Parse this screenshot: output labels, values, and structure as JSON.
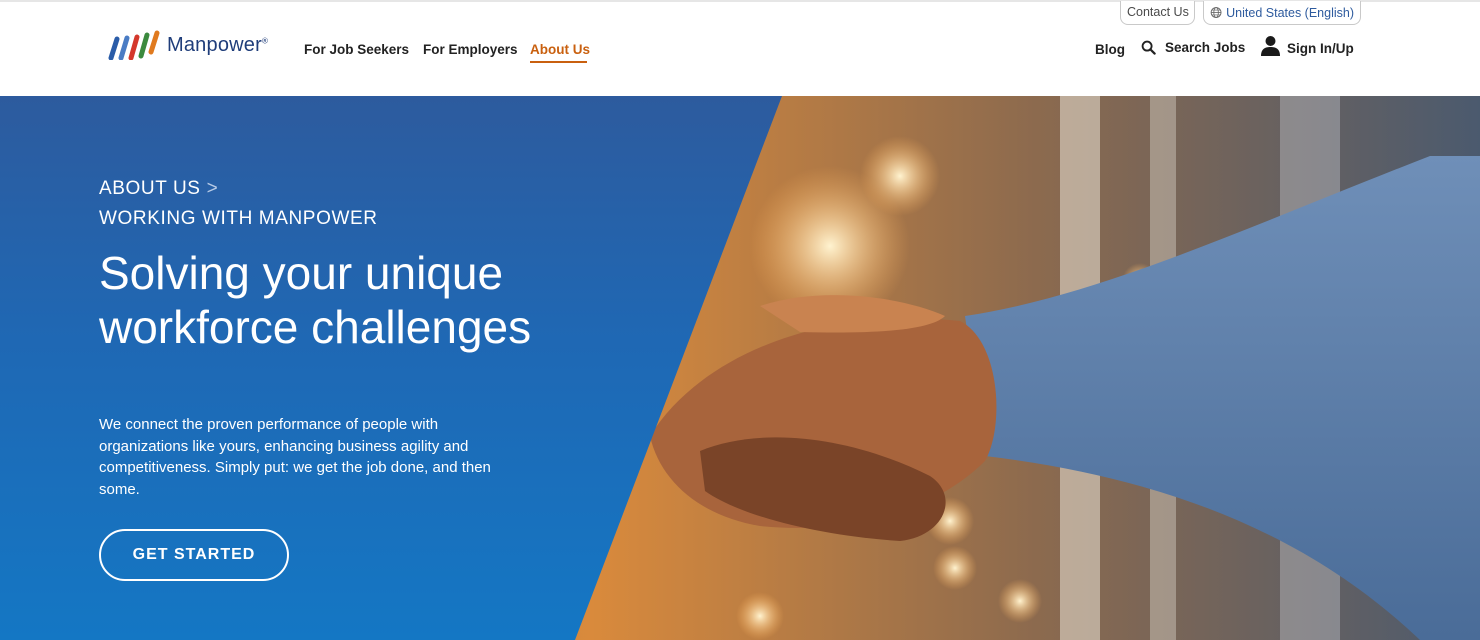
{
  "utility": {
    "contact_label": "Contact Us",
    "country_label": "United States (English)"
  },
  "logo": {
    "wordmark": "Manpower",
    "reg": "®"
  },
  "nav": {
    "items": [
      {
        "label": "For Job Seekers"
      },
      {
        "label": "For Employers"
      },
      {
        "label": "About Us",
        "active": true
      }
    ],
    "blog": "Blog",
    "search": "Search Jobs",
    "signin": "Sign In/Up"
  },
  "hero": {
    "crumb_primary": "ABOUT US",
    "crumb_separator": ">",
    "crumb_secondary": "WORKING WITH MANPOWER",
    "headline": "Solving your unique workforce challenges",
    "lede": "We connect the proven performance of people with organizations like yours, enhancing business agility and competitiveness. Simply put: we get the job done, and then some.",
    "cta": "GET STARTED"
  },
  "colors": {
    "accent_orange": "#c9600f",
    "brand_navy": "#1f3d7a",
    "hero_blue": "#1f68b4"
  },
  "icons": [
    "globe-icon",
    "search-icon",
    "user-icon"
  ]
}
